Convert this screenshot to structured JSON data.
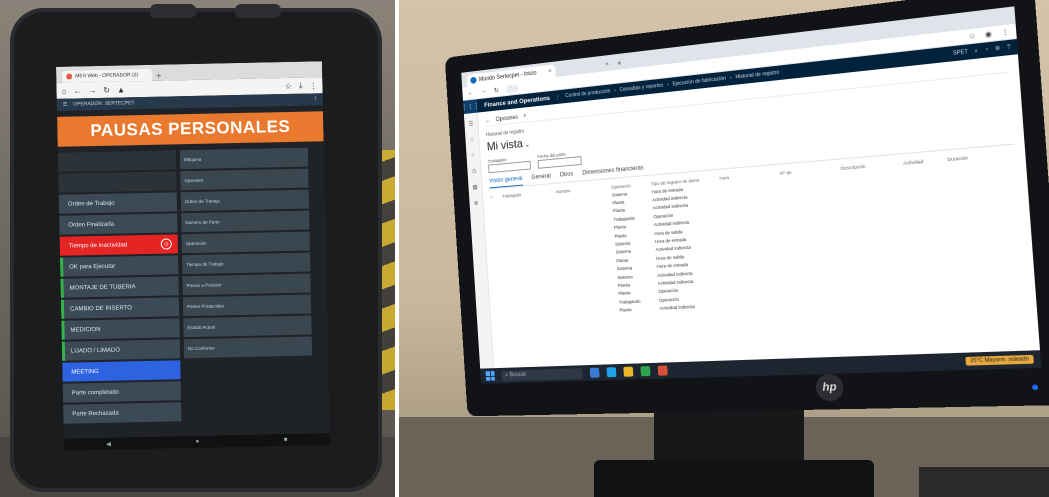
{
  "tablet": {
    "browser": {
      "tab_title": "MES Web - OPERADOR (2)",
      "new_tab": "+"
    },
    "app_header": {
      "title": "OPERADOR: SERTECPET"
    },
    "banner": "PAUSAS PERSONALES",
    "left_buttons": [
      {
        "label": "",
        "style": "blank"
      },
      {
        "label": "",
        "style": "blank"
      },
      {
        "label": "Orden de Trabajo",
        "style": "normal"
      },
      {
        "label": "Orden Finalizada",
        "style": "normal"
      },
      {
        "label": "Tiempo de Inactividad",
        "style": "red"
      },
      {
        "label": "OK para Ejecutar",
        "style": "green"
      },
      {
        "label": "MONTAJE DE TUBERIA",
        "style": "green"
      },
      {
        "label": "CAMBIO DE INSERTO",
        "style": "green"
      },
      {
        "label": "MEDICION",
        "style": "green"
      },
      {
        "label": "LIJADO / LIMADO",
        "style": "green"
      },
      {
        "label": "MEETING",
        "style": "blue"
      },
      {
        "label": "Parte completado",
        "style": "normal"
      },
      {
        "label": "Parte Rechazada",
        "style": "normal"
      }
    ],
    "right_buttons": [
      {
        "label": "Máquina"
      },
      {
        "label": "Operador"
      },
      {
        "label": "Orden de Trabajo"
      },
      {
        "label": "Número de Parte"
      },
      {
        "label": "Operación"
      },
      {
        "label": "Tiempo de Trabajo"
      },
      {
        "label": "Piezas a Producir"
      },
      {
        "label": "Partes Producidas"
      },
      {
        "label": "Estado Actual"
      },
      {
        "label": "No Conforme"
      }
    ]
  },
  "monitor": {
    "browser": {
      "tab_title": "Mundo Sertecpet - Inicio",
      "tab_close": "×",
      "new_tab": "+"
    },
    "fo": {
      "waffle": "⋮⋮⋮",
      "app_title": "Finance and Operations",
      "breadcrumb": [
        "Control de producción",
        "Consultas y reportes",
        "Ejecución de fabricación",
        "Historial de registro"
      ],
      "company": "SPET"
    },
    "command_bar": {
      "back": "←",
      "options": "Opciones",
      "search": "⌕"
    },
    "page": {
      "subtitle": "Historial de registro",
      "view_name": "Mi vista",
      "filters": [
        {
          "label": "Trabajador"
        },
        {
          "label": "Fecha del parte"
        }
      ],
      "pivots": [
        "Visión general",
        "General",
        "Otros",
        "Dimensiones financieras"
      ],
      "active_pivot": "Visión general"
    },
    "grid": {
      "headers": [
        "",
        "Trabajador",
        "Nombre",
        "Operación",
        "Tipo de registro de datos",
        "Hora",
        "Nº de",
        "Descripción",
        "Actividad",
        "Duración"
      ],
      "rows": [
        {
          "operacion": "Sistema",
          "tipo": "Hora de entrada"
        },
        {
          "operacion": "Planta",
          "tipo": "Actividad indirecta"
        },
        {
          "operacion": "Planta",
          "tipo": "Actividad indirecta"
        },
        {
          "operacion": "Trabajando",
          "tipo": "Operación"
        },
        {
          "operacion": "Planta",
          "tipo": "Actividad indirecta"
        },
        {
          "operacion": "Planta",
          "tipo": "Hora de salida"
        },
        {
          "operacion": "Sistema",
          "tipo": "Hora de entrada"
        },
        {
          "operacion": "Sistema",
          "tipo": "Actividad indirecta"
        },
        {
          "operacion": "Planta",
          "tipo": "Hora de salida"
        },
        {
          "operacion": "Sistema",
          "tipo": "Hora de entrada"
        },
        {
          "operacion": "Sistema",
          "tipo": "Actividad indirecta"
        },
        {
          "operacion": "Planta",
          "tipo": "Actividad indirecta"
        },
        {
          "operacion": "Planta",
          "tipo": "Operación"
        },
        {
          "operacion": "Trabajando",
          "tipo": "Operación"
        },
        {
          "operacion": "Planta",
          "tipo": "Actividad indirecta"
        }
      ]
    },
    "taskbar": {
      "search_placeholder": "Buscar",
      "weather": "26°C Mayorm. soleado"
    },
    "brand": "hp"
  }
}
